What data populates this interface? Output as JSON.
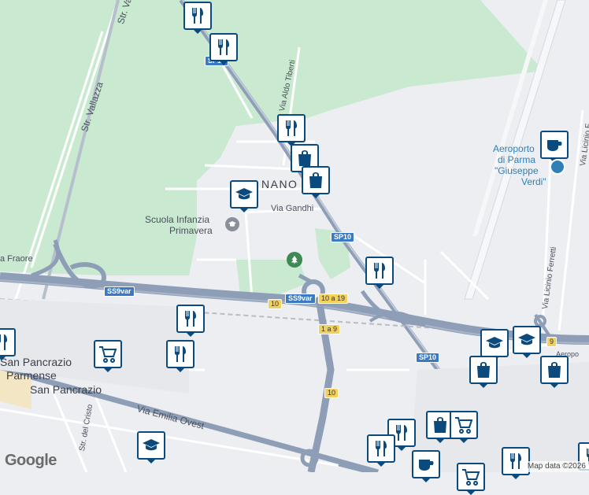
{
  "labels": {
    "str_vallazza_top": "Str. Vallazza",
    "str_vallazza": "Str. Vallazza",
    "via_aldo_tiberti": "Via Aldo Tiberti",
    "town_partial": "NANO",
    "via_gandhi": "Via Gandhi",
    "school_name_line1": "Scuola Infanzia",
    "school_name_line2": "Primavera",
    "airport_line1": "Aeroporto",
    "airport_line2": "di Parma",
    "airport_line3": "\"Giuseppe",
    "airport_line4": "Verdi\"",
    "via_licinio_top": "Via Licinio F",
    "via_licinio_ferretti": "Via Licinio Ferretti",
    "via_fraore": "a Fraore",
    "san_pancrazio_parmense_1": "San Pancrazio",
    "san_pancrazio_parmense_2": "Parmense",
    "san_pancrazio": "San Pancrazio",
    "via_emilia_ovest": "Via Emilia Ovest",
    "str_del_cristo": "Str. del Cristo",
    "aeroporto_small": "Aeropo"
  },
  "shields": {
    "sp10_top": "SP10",
    "sp10_mid": "SP10",
    "sp10_bottom": "SP10",
    "ss9var_left": "SS9var",
    "ss9var_center": "SS9var",
    "exit_10_a": "10",
    "exit_10_19": "10 a 19",
    "exit_1_9": "1 a 9",
    "exit_10_b": "10",
    "exit_9": "9"
  },
  "pois": [
    {
      "type": "restaurant",
      "icon": "fork-knife-icon"
    },
    {
      "type": "restaurant",
      "icon": "fork-knife-icon"
    },
    {
      "type": "restaurant",
      "icon": "fork-knife-icon"
    },
    {
      "type": "shopping",
      "icon": "shopping-bag-icon"
    },
    {
      "type": "shopping",
      "icon": "shopping-bag-icon"
    },
    {
      "type": "school",
      "icon": "graduation-cap-icon"
    },
    {
      "type": "restaurant",
      "icon": "fork-knife-icon"
    },
    {
      "type": "restaurant",
      "icon": "fork-knife-icon"
    },
    {
      "type": "grocery",
      "icon": "shopping-cart-icon"
    },
    {
      "type": "restaurant",
      "icon": "fork-knife-icon"
    },
    {
      "type": "cafe",
      "icon": "coffee-cup-icon"
    },
    {
      "type": "school",
      "icon": "graduation-cap-icon"
    },
    {
      "type": "school",
      "icon": "graduation-cap-icon"
    },
    {
      "type": "shopping",
      "icon": "shopping-bag-icon"
    },
    {
      "type": "shopping",
      "icon": "shopping-bag-icon"
    },
    {
      "type": "shopping",
      "icon": "shopping-bag-icon"
    },
    {
      "type": "grocery",
      "icon": "shopping-cart-icon"
    },
    {
      "type": "restaurant",
      "icon": "fork-knife-icon"
    },
    {
      "type": "restaurant",
      "icon": "fork-knife-icon"
    },
    {
      "type": "school",
      "icon": "graduation-cap-icon"
    },
    {
      "type": "cafe",
      "icon": "coffee-cup-icon"
    },
    {
      "type": "restaurant",
      "icon": "fork-knife-icon"
    },
    {
      "type": "restaurant",
      "icon": "fork-knife-icon"
    }
  ],
  "brand": "Google",
  "attribution": "Map data ©2026",
  "colors": {
    "park_green": "#c9ead0",
    "land": "#eceef2",
    "highway": "#8e9eb6",
    "road": "#ffffff",
    "poi_border": "#0a4a7c"
  }
}
